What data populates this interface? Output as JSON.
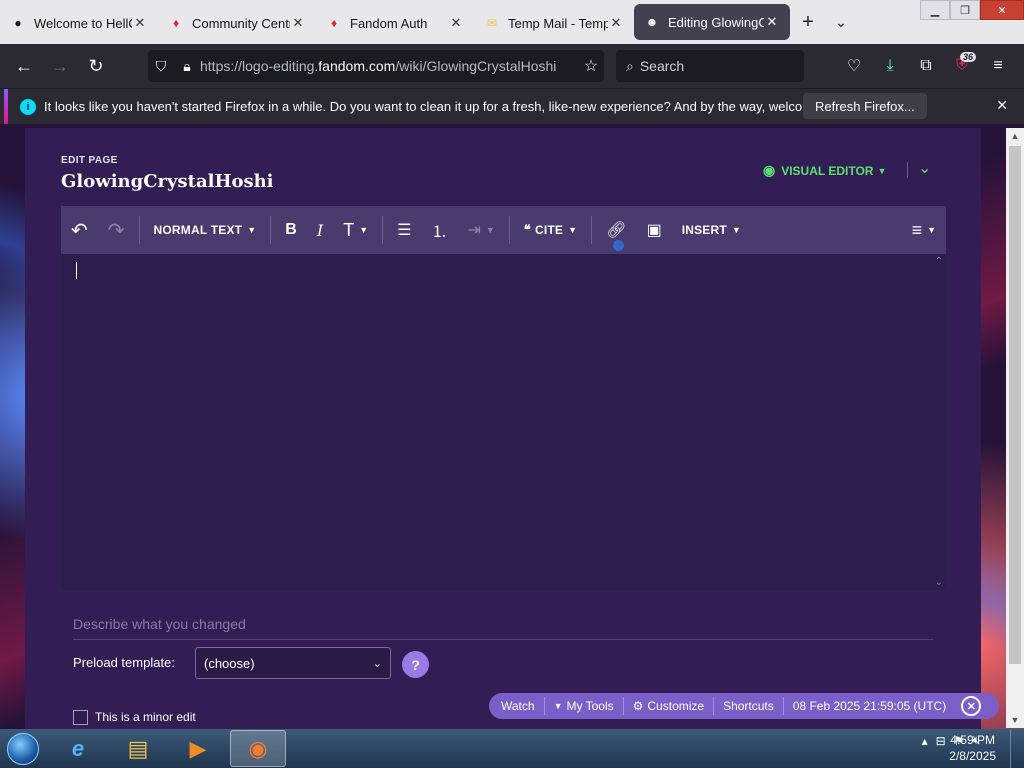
{
  "tabs": [
    {
      "title": "Welcome to HellC",
      "favicon": "globe-icon",
      "active": false
    },
    {
      "title": "Community Centr",
      "favicon": "fandom-flame-icon",
      "active": false
    },
    {
      "title": "Fandom Auth",
      "favicon": "fandom-flame-icon",
      "active": false
    },
    {
      "title": "Temp Mail - Temp",
      "favicon": "mail-icon",
      "active": false
    },
    {
      "title": "Editing GlowingCr",
      "favicon": "wiki-avatar-icon",
      "active": true
    }
  ],
  "navbar": {
    "url_prefix": "https://logo-editing.",
    "url_host": "fandom.com",
    "url_path": "/wiki/GlowingCrystalHoshi",
    "search_placeholder": "Search",
    "extensions_badge": "36"
  },
  "notification": {
    "message": "It looks like you haven't started Firefox in a while. Do you want to clean it up for a fresh, like-new experience? And by the way, welcome back!",
    "button": "Refresh Firefox..."
  },
  "editor": {
    "edit_label": "EDIT PAGE",
    "page_title": "GlowingCrystalHoshi",
    "mode_label": "VISUAL EDITOR",
    "toolbar": {
      "format_label": "NORMAL TEXT",
      "cite_label": "CITE",
      "insert_label": "INSERT"
    },
    "summary_placeholder": "Describe what you changed",
    "preload_label": "Preload template:",
    "preload_value": "(choose)",
    "help_label": "?",
    "minor_label": "This is a minor edit"
  },
  "floating_toolbar": {
    "watch": "Watch",
    "my_tools": "My Tools",
    "customize": "Customize",
    "shortcuts": "Shortcuts",
    "timestamp": "08 Feb 2025 21:59:05 (UTC)"
  },
  "taskbar": {
    "time": "4:59 PM",
    "date": "2/8/2025"
  },
  "colors": {
    "accent_green": "#5be06b",
    "card_bg": "#321e55",
    "toolbar_bg": "#4a3b6e",
    "floating_bar": "#7b5fc9"
  }
}
